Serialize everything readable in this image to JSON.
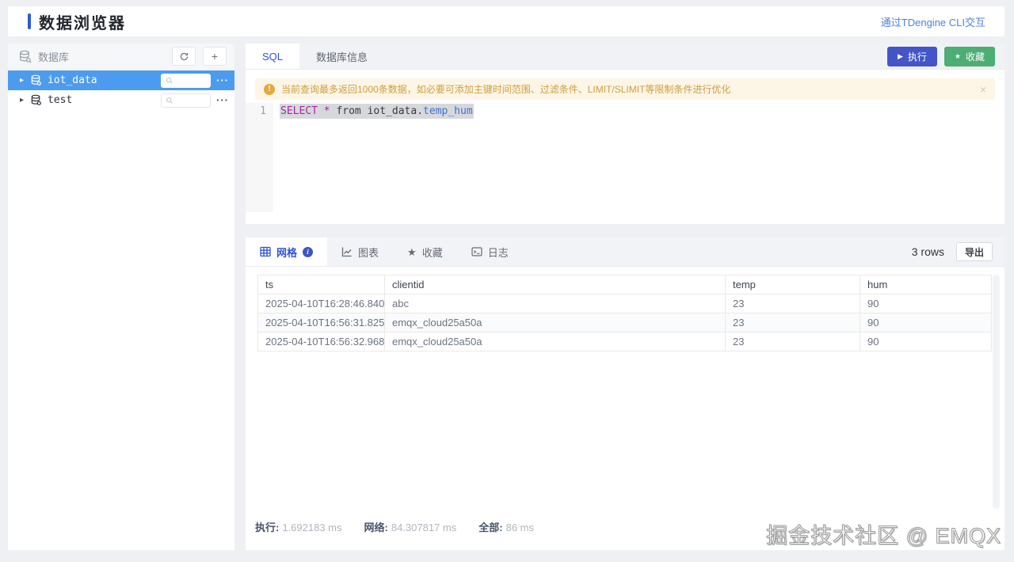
{
  "page": {
    "title": "数据浏览器",
    "cli_link": "通过TDengine CLI交互"
  },
  "glyphs": {
    "caret": "▸",
    "plus": "+",
    "more": "···",
    "play": "▶",
    "star": "★",
    "warning": "!",
    "info": "i",
    "close": "×"
  },
  "sidebar": {
    "header_label": "数据库",
    "items": [
      {
        "name": "iot_data",
        "selected": true
      },
      {
        "name": "test",
        "selected": false
      }
    ]
  },
  "editor": {
    "tabs": [
      {
        "label": "SQL"
      },
      {
        "label": "数据库信息"
      }
    ],
    "run_button": "执行",
    "favorite_button": "收藏",
    "warning": "当前查询最多返回1000条数据，如必要可添加主键时间范围、过滤条件、LIMIT/SLIMIT等限制条件进行优化",
    "line_number": "1",
    "sql": {
      "keyword": "SELECT",
      "star": " * ",
      "from_kw": "from ",
      "table": "iot_data",
      "dot": ".",
      "column": "temp_hum"
    }
  },
  "results": {
    "tabs": [
      {
        "label": "网格"
      },
      {
        "label": "图表"
      },
      {
        "label": "收藏"
      },
      {
        "label": "日志"
      }
    ],
    "row_count": "3 rows",
    "export_button": "导出",
    "table": {
      "columns": [
        "ts",
        "clientid",
        "temp",
        "hum"
      ],
      "rows": [
        [
          "2025-04-10T16:28:46.840...",
          "abc",
          "23",
          "90"
        ],
        [
          "2025-04-10T16:56:31.825...",
          "emqx_cloud25a50a",
          "23",
          "90"
        ],
        [
          "2025-04-10T16:56:32.968...",
          "emqx_cloud25a50a",
          "23",
          "90"
        ]
      ]
    },
    "stats": [
      {
        "label": "执行:",
        "value": "1.692183 ms"
      },
      {
        "label": "网络:",
        "value": "84.307817 ms"
      },
      {
        "label": "全部:",
        "value": "86 ms"
      }
    ]
  },
  "watermark": "掘金技术社区 @ EMQX",
  "colors": {
    "page_bg": "#eef0f3",
    "accent_blue": "#2b5bd7",
    "selected_tree_blue": "#4d9bee",
    "active_tab_blue": "#2f54d8",
    "run_button": "#4355c8",
    "favorite_button": "#4cae73",
    "warning_bg": "#fdf6e7",
    "warning_icon": "#e2a93d",
    "warning_text": "#cf9c40",
    "link_blue": "#4c82e6",
    "sql_keyword": "#a626a4",
    "sql_column": "#4271d6"
  }
}
